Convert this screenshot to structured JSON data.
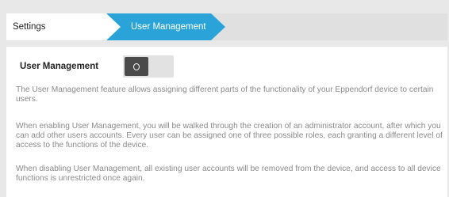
{
  "breadcrumb": {
    "settings_label": "Settings",
    "current_label": "User Management"
  },
  "user_management": {
    "label": "User Management",
    "toggle_state": "off",
    "paragraphs": [
      "The User Management feature allows assigning different parts of the functionality of your Eppendorf device to certain users.",
      "When enabling User Management, you will be walked through the creation of an administrator account, after which you can add other users accounts. Every user can be assigned one of three possible roles, each granting a different level of access to the functions of the device.",
      "When disabling User Management, all existing user accounts will be removed from the device, and access to all device functions is unrestricted once again."
    ]
  },
  "colors": {
    "accent": "#2aa4d8",
    "toggle_knob": "#4a4a4a",
    "toggle_track": "#e2e2e2"
  }
}
